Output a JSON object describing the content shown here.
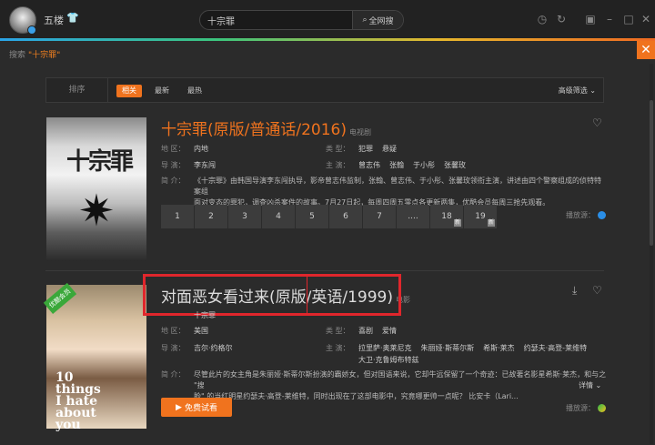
{
  "user": {
    "name": "五楼",
    "badge_icon": "vip-badge-icon"
  },
  "search": {
    "value": "十宗罪",
    "button_label": "全网搜"
  },
  "crumb": {
    "prefix": "搜索",
    "keyword": "\"十宗罪\""
  },
  "filter": {
    "sort_label": "排序",
    "options": [
      "相关",
      "最新",
      "最热"
    ],
    "active": "相关",
    "advanced": "高级筛选"
  },
  "entries": [
    {
      "title": "十宗罪(原版/普通话/2016)",
      "type": "电视剧",
      "region_label": "地 区：",
      "region": "内地",
      "genre_label": "类 型：",
      "genres": [
        "犯罪",
        "悬疑"
      ],
      "director_label": "导 演：",
      "director": "李东闯",
      "cast_label": "主 演：",
      "cast": [
        "曾志伟",
        "张翰",
        "于小彤",
        "张馨玫"
      ],
      "desc_label": "简 介：",
      "desc_lines": [
        "《十宗罪》由韩国导演李东闯执导，影帝曾志伟监制，张翰、曾志伟、于小彤、张馨玫领衔主演，讲述由四个警察组成的侦特特案组",
        "面对变态的罪犯，调查凶杀案件的故事。7月27日起，每周四周五零点各更新两集，优酷会员每周三抢先观看。"
      ],
      "episodes": [
        "1",
        "2",
        "3",
        "4",
        "5",
        "6",
        "7",
        "....",
        "18",
        "19"
      ],
      "episode_new": [
        "18",
        "19"
      ],
      "new_badge": "新",
      "source_label": "播放源："
    },
    {
      "title": "对面恶女看过来(原版/英语/1999)",
      "type": "电影",
      "alias": "十宗罪",
      "region_label": "地 区：",
      "region": "美国",
      "genre_label": "类 型：",
      "genres": [
        "喜剧",
        "爱情"
      ],
      "director_label": "导 演：",
      "director": "吉尔·约格尔",
      "cast_label": "主 演：",
      "cast": [
        "拉里萨·奥莱尼克",
        "朱丽娅·斯蒂尔斯",
        "希斯·莱杰",
        "约瑟夫·高登-莱维特"
      ],
      "cast_line2": "大卫·克鲁姆布特兹",
      "desc_label": "简 介：",
      "desc_lines": [
        "尽管此片的女主角是朱丽娅·斯蒂尔斯扮演的霸娇女，但对国语来说，它却牛远保留了一个奇迹：已故著名影星希斯·莱杰，和与之 \"搜",
        "脸\" 的当红明星约瑟夫·高登-莱维特，同时出现在了这部电影中，究竟哪更帅一点呢？      比安卡（Lari..."
      ],
      "detail": "详情",
      "play_button": "免费试看",
      "source_label": "播放源：",
      "poster_ribbon": "优酷会员",
      "poster_text": "10 things I hate about you"
    }
  ],
  "poster1_title": "十宗罪"
}
